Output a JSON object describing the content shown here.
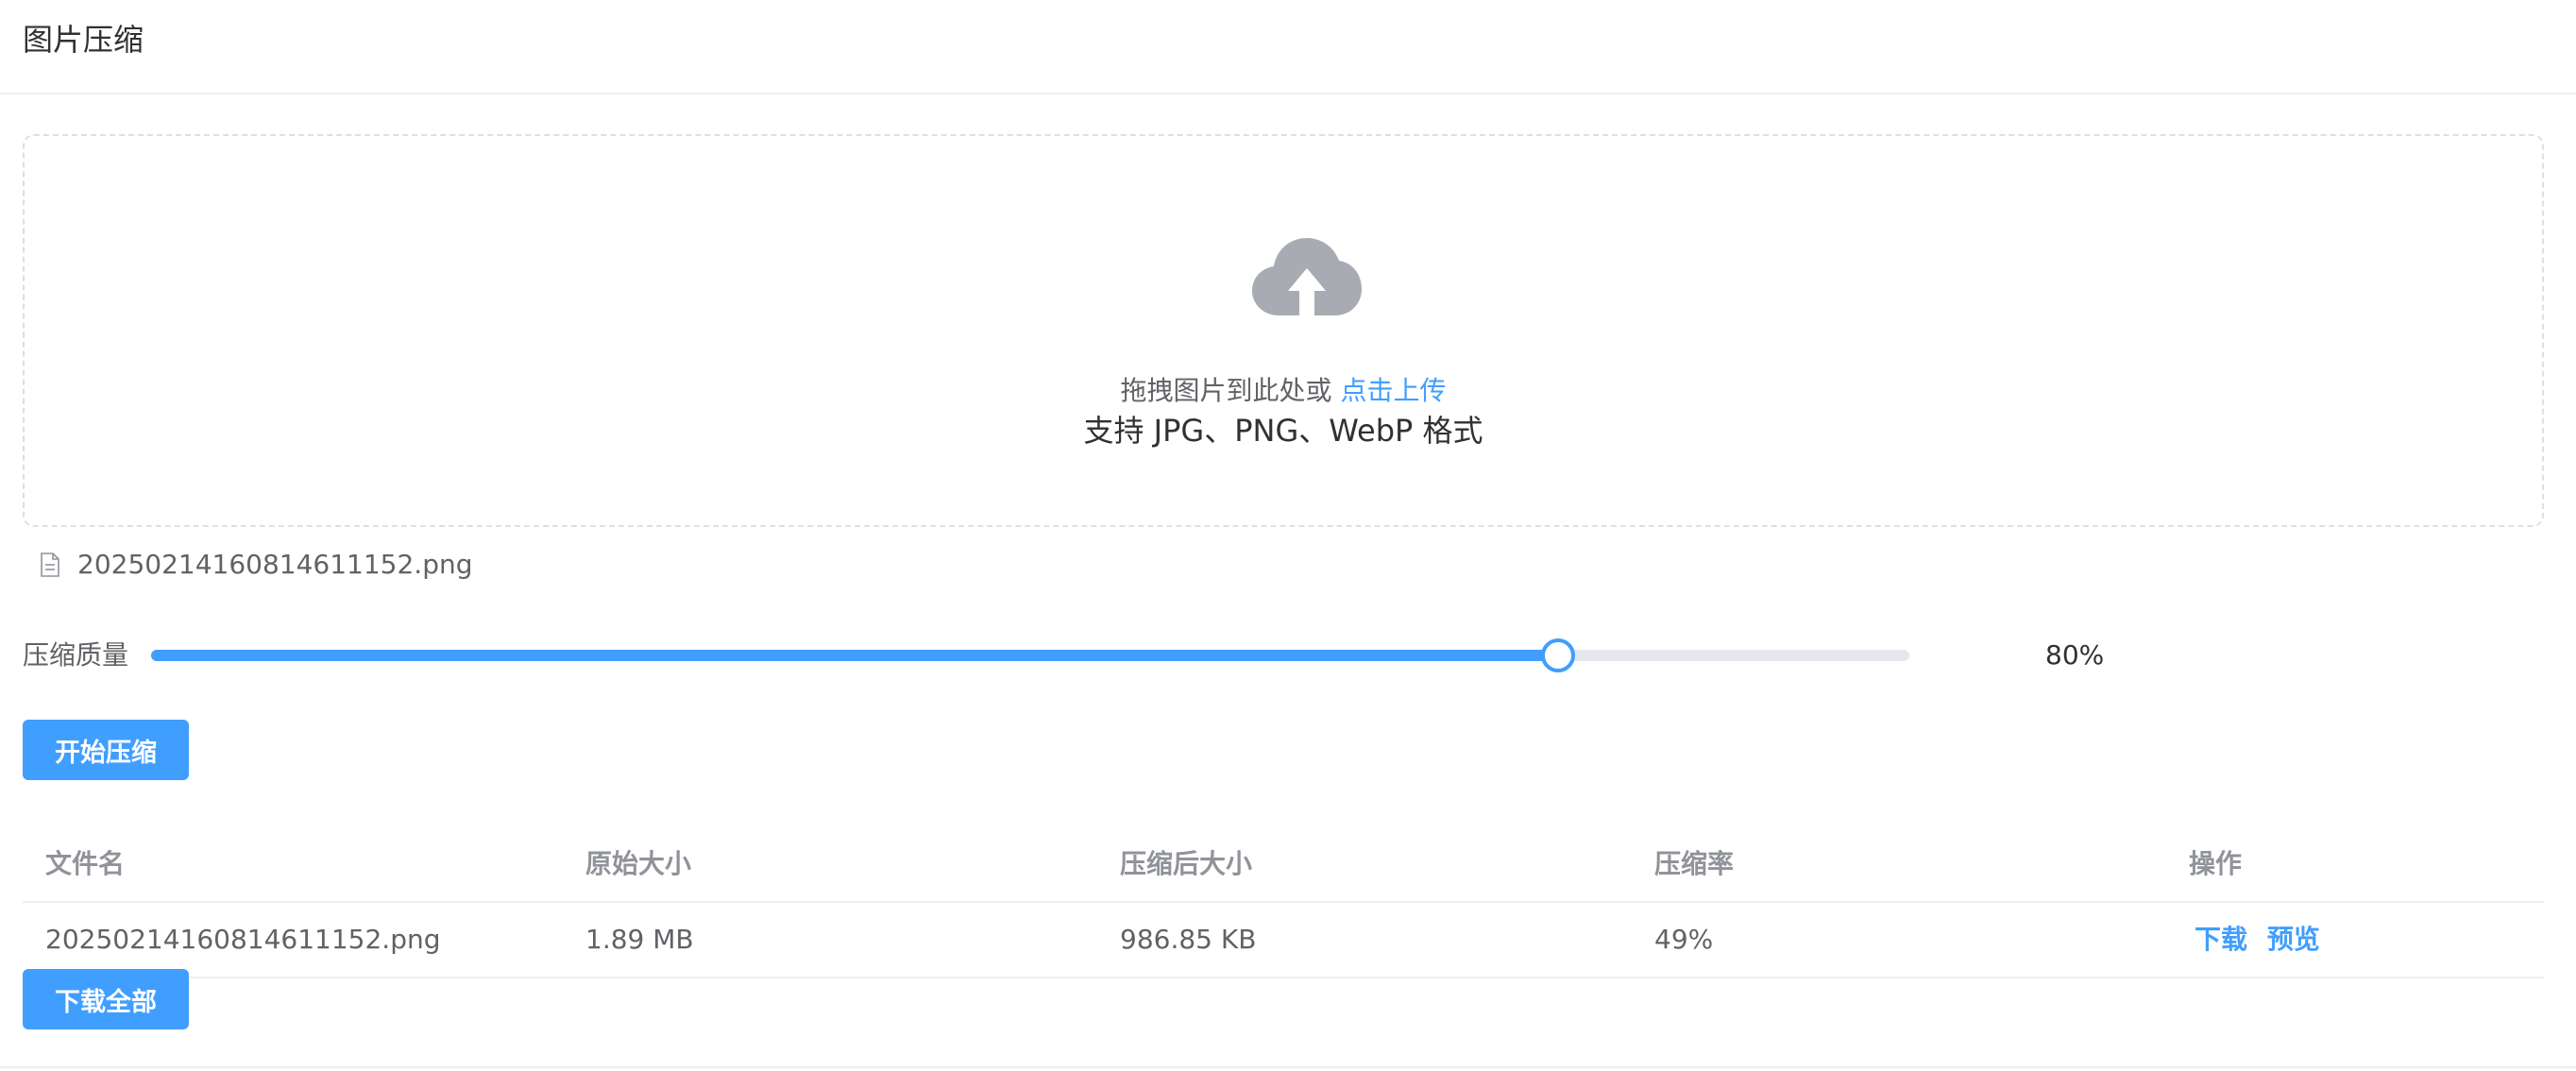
{
  "header": {
    "title": "图片压缩"
  },
  "upload": {
    "drag_text": "拖拽图片到此处或",
    "click_text": "点击上传",
    "tip": "支持 JPG、PNG、WebP 格式",
    "icon": "upload-cloud-icon"
  },
  "file_list": [
    {
      "name": "20250214160814611152.png",
      "icon": "document-icon"
    }
  ],
  "quality": {
    "label": "压缩质量",
    "value_percent": 80,
    "value_text": "80%"
  },
  "buttons": {
    "compress": "开始压缩",
    "download_all": "下载全部"
  },
  "table": {
    "columns": [
      "文件名",
      "原始大小",
      "压缩后大小",
      "压缩率",
      "操作"
    ],
    "rows": [
      {
        "file_name": "20250214160814611152.png",
        "original_size": "1.89 MB",
        "compressed_size": "986.85 KB",
        "ratio": "49%",
        "actions": {
          "download": "下载",
          "preview": "预览"
        }
      }
    ]
  },
  "colors": {
    "primary": "#409eff",
    "icon_gray": "#a8abb2",
    "border": "#ebeef5"
  }
}
